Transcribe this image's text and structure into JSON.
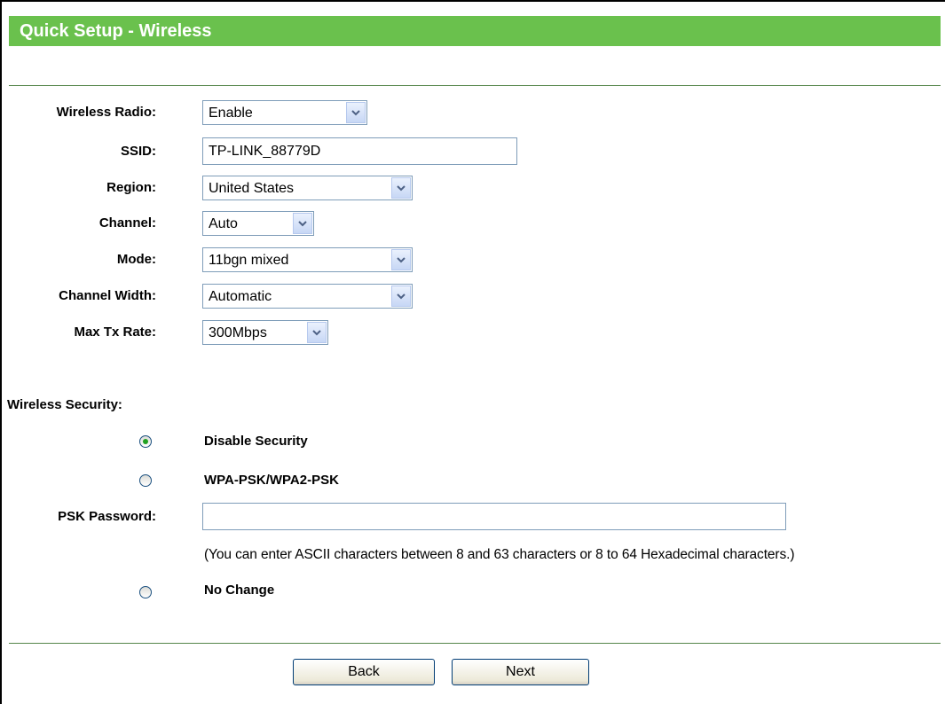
{
  "header": {
    "title": "Quick Setup - Wireless"
  },
  "form": {
    "wireless_radio": {
      "label": "Wireless Radio:",
      "value": "Enable"
    },
    "ssid": {
      "label": "SSID:",
      "value": "TP-LINK_88779D"
    },
    "region": {
      "label": "Region:",
      "value": "United States"
    },
    "channel": {
      "label": "Channel:",
      "value": "Auto"
    },
    "mode": {
      "label": "Mode:",
      "value": "11bgn mixed"
    },
    "channel_width": {
      "label": "Channel Width:",
      "value": "Automatic"
    },
    "max_tx_rate": {
      "label": "Max Tx Rate:",
      "value": "300Mbps"
    }
  },
  "security": {
    "label": "Wireless Security:",
    "options": [
      {
        "label": "Disable Security",
        "selected": true
      },
      {
        "label": "WPA-PSK/WPA2-PSK",
        "selected": false
      },
      {
        "label": "No Change",
        "selected": false
      }
    ],
    "psk_label": "PSK Password:",
    "psk_value": "",
    "hint": "(You can enter ASCII characters between 8 and 63 characters or 8 to 64 Hexadecimal characters.)"
  },
  "buttons": {
    "back": "Back",
    "next": "Next"
  },
  "colors": {
    "header_bg": "#6ac14d",
    "divider": "#55864a",
    "radio_dot": "#21a121"
  }
}
